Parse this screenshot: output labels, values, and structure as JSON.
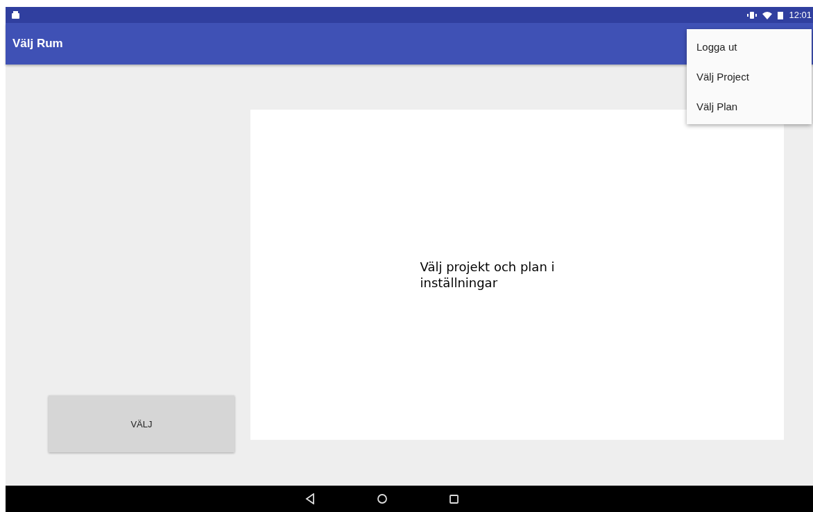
{
  "status_bar": {
    "time": "12:01"
  },
  "app_bar": {
    "title": "Välj Rum"
  },
  "choose_button": {
    "label": "VÄLJ"
  },
  "panel": {
    "message": "Välj projekt och plan i inställningar"
  },
  "menu": {
    "items": [
      {
        "label": "Logga ut"
      },
      {
        "label": "Välj Project"
      },
      {
        "label": "Välj Plan"
      }
    ]
  }
}
